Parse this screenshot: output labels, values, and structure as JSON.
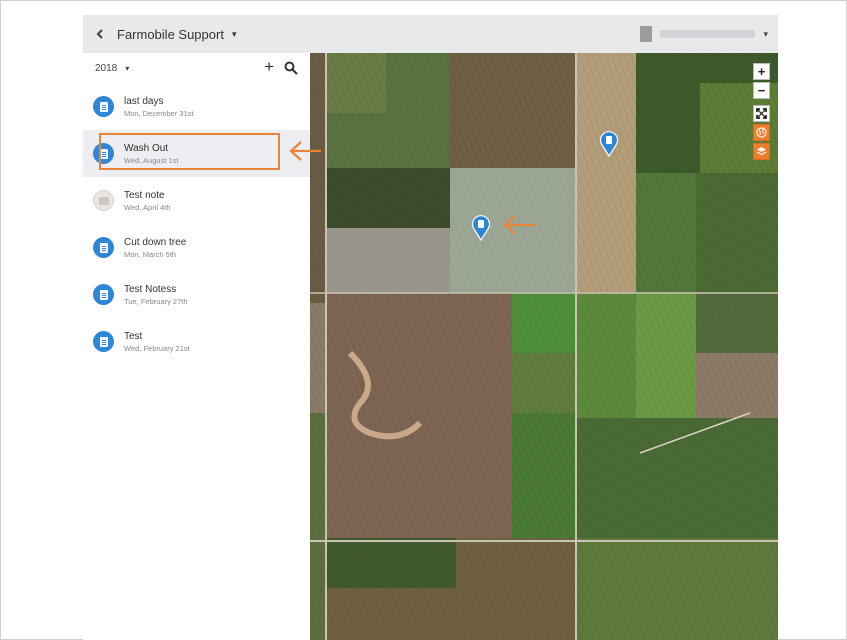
{
  "topbar": {
    "back_icon": "chevron-left-icon",
    "org_title": "Farmobile Support",
    "org_caret": "▾",
    "user_caret": "▾"
  },
  "sidebar": {
    "year": "2018",
    "year_caret": "▾",
    "add_label": "+",
    "notes": [
      {
        "title": "last days",
        "date": "Mon, December 31st",
        "icon": "document-icon",
        "selected": false
      },
      {
        "title": "Wash Out",
        "date": "Wed, August 1st",
        "icon": "document-icon",
        "selected": true
      },
      {
        "title": "Test note",
        "date": "Wed, April 4th",
        "icon": "photo-thumbnail-icon",
        "selected": false
      },
      {
        "title": "Cut down tree",
        "date": "Mon, March 5th",
        "icon": "document-icon",
        "selected": false
      },
      {
        "title": "Test Notess",
        "date": "Tue, February 27th",
        "icon": "document-icon",
        "selected": false
      },
      {
        "title": "Test",
        "date": "Wed, February 21st",
        "icon": "document-icon",
        "selected": false
      }
    ]
  },
  "map": {
    "zoom_in": "+",
    "zoom_out": "−",
    "controls": [
      "zoom-in-icon",
      "zoom-out-icon",
      "fullscreen-icon",
      "globe-icon",
      "layers-icon"
    ],
    "accent_color": "#ef7d2c",
    "pin_color": "#2f86d6"
  },
  "annotations": {
    "highlight_color": "#e8843a"
  }
}
